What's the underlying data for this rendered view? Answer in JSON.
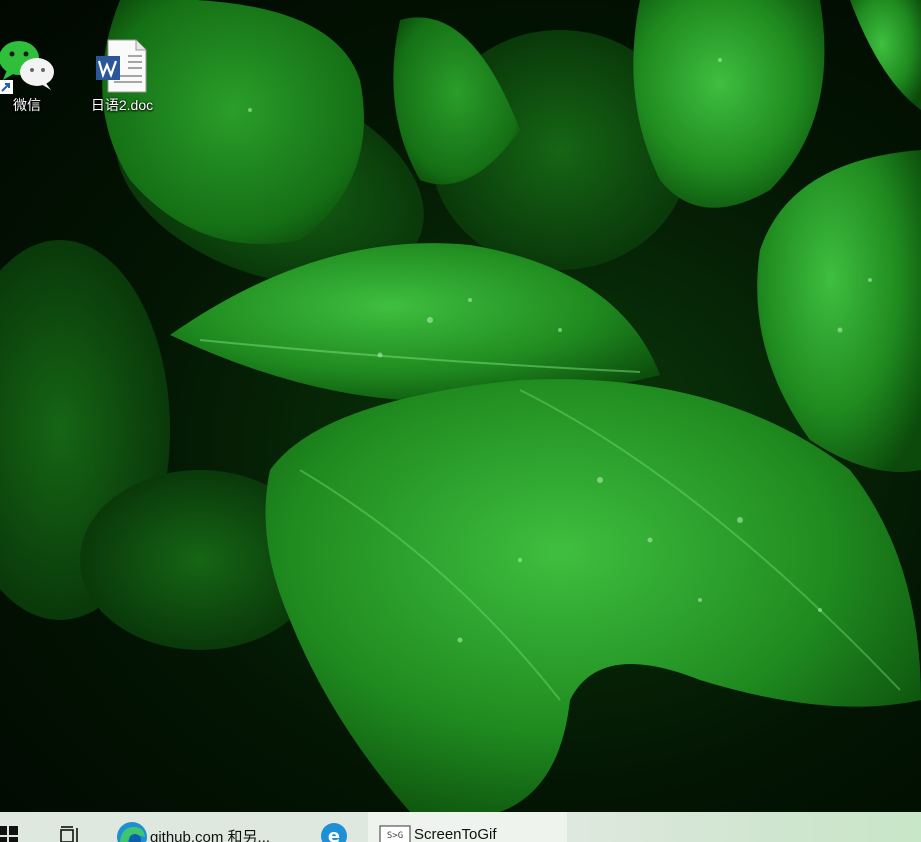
{
  "desktop": {
    "icons": [
      {
        "label": "微信",
        "icon": "wechat-icon",
        "shortcut": true
      },
      {
        "label": "日语2.doc",
        "icon": "word-document-icon"
      }
    ]
  },
  "taskbar": {
    "start_icon": "windows-logo-icon",
    "task_view_icon": "task-view-icon",
    "items": [
      {
        "label": "github.com 和另...",
        "icon": "edge-icon"
      },
      {
        "label": "",
        "icon": "internet-explorer-icon"
      },
      {
        "label": "ScreenToGif",
        "icon": "screentogif-icon",
        "active": true
      }
    ]
  },
  "colors": {
    "leaf_bright": "#2fa22f",
    "leaf_dark": "#0b4a0b",
    "background": "#020a02",
    "taskbar": "#dfe8df"
  }
}
